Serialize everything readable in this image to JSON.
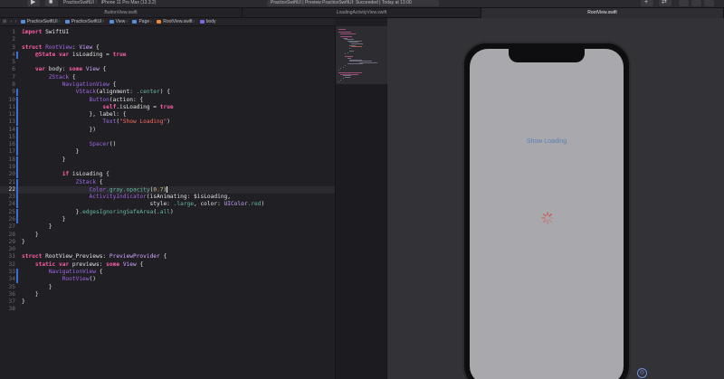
{
  "toolbar": {
    "scheme_app": "PracticeSwiftUI",
    "scheme_device": "iPhone 11 Pro Max (13.3.2)",
    "status_text": "PracticeSwiftUI | Preview PracticeSwiftUI: Succeeded | Today at 13:00"
  },
  "tabs": [
    {
      "label": "ButtonView.swift"
    },
    {
      "label": "LoadingActivityView.swift"
    },
    {
      "label": "RootView.swift"
    }
  ],
  "jumpbar": {
    "items": [
      "PracticeSwiftUI",
      "PracticeSwiftUI",
      "View",
      "Page",
      "RootView.swift",
      "body"
    ]
  },
  "editor": {
    "current_line": 22,
    "lines": [
      "import SwiftUI",
      "",
      "struct RootView: View {",
      "    @State var isLoading = true",
      "",
      "    var body: some View {",
      "        ZStack {",
      "            NavigationView {",
      "                VStack(alignment: .center) {",
      "                    Button(action: {",
      "                        self.isLoading = true",
      "                    }, label: {",
      "                        Text(\"Show Loading\")",
      "                    })",
      "",
      "                    Spacer()",
      "                }",
      "            }",
      "",
      "            if isLoading {",
      "                ZStack {",
      "                    Color.gray.opacity(0.7)",
      "                    ActivityIndicator(isAnimating: $isLoading,",
      "                                      style: .large, color: UIColor.red)",
      "                }.edgesIgnoringSafeArea(.all)",
      "            }",
      "        }",
      "    }",
      "}",
      "",
      "struct RootView_Previews: PreviewProvider {",
      "    static var previews: some View {",
      "        NavigationView {",
      "            RootView()",
      "        }",
      "    }",
      "}",
      ""
    ]
  },
  "preview": {
    "button_label": "Show Loading",
    "spinner_color": "#d8443a"
  }
}
